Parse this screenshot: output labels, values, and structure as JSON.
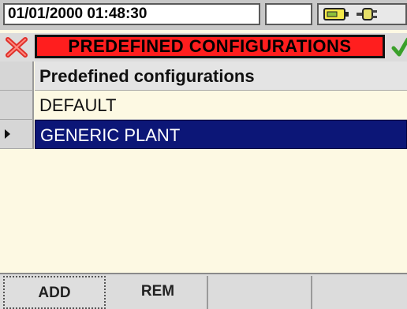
{
  "status": {
    "datetime": "01/01/2000 01:48:30",
    "icons": [
      "battery-icon",
      "plug-icon"
    ]
  },
  "title": {
    "text": "PREDEFINED CONFIGURATIONS",
    "cancel_icon": "close-icon",
    "confirm_icon": "checkmark-icon",
    "accent": "#ff1e1e"
  },
  "table": {
    "header": "Predefined configurations",
    "rows": [
      {
        "label": "DEFAULT",
        "selected": false
      },
      {
        "label": "GENERIC PLANT",
        "selected": true
      }
    ],
    "selection_color": "#0c1677"
  },
  "softkeys": [
    "ADD",
    "REM",
    "",
    ""
  ]
}
